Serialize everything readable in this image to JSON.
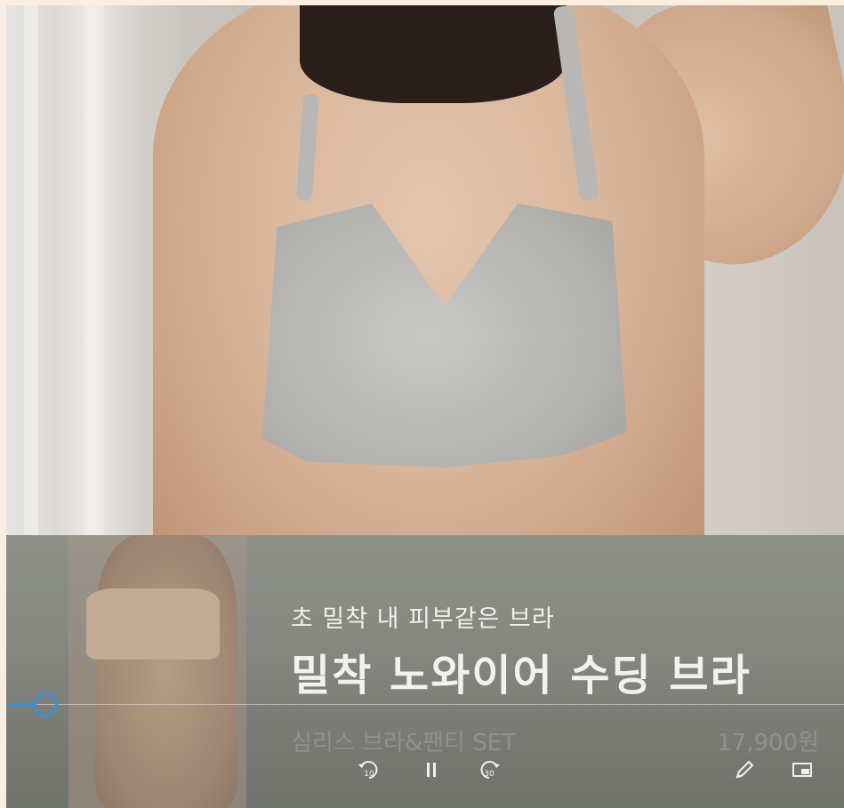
{
  "product": {
    "subtitle": "초 밀착 내 피부같은 브라",
    "title": "밀착 노와이어 수딩 브라",
    "set_label": "심리스 브라&팬티 SET",
    "price": "17,900원"
  },
  "player": {
    "rewind_seconds": "10",
    "forward_seconds": "30",
    "progress": 0.05,
    "icons": [
      "rewind-10-icon",
      "pause-icon",
      "forward-30-icon",
      "pencil-icon",
      "pip-icon"
    ]
  },
  "colors": {
    "accent": "#3d8fd8",
    "page_border": "#fbeee0"
  }
}
